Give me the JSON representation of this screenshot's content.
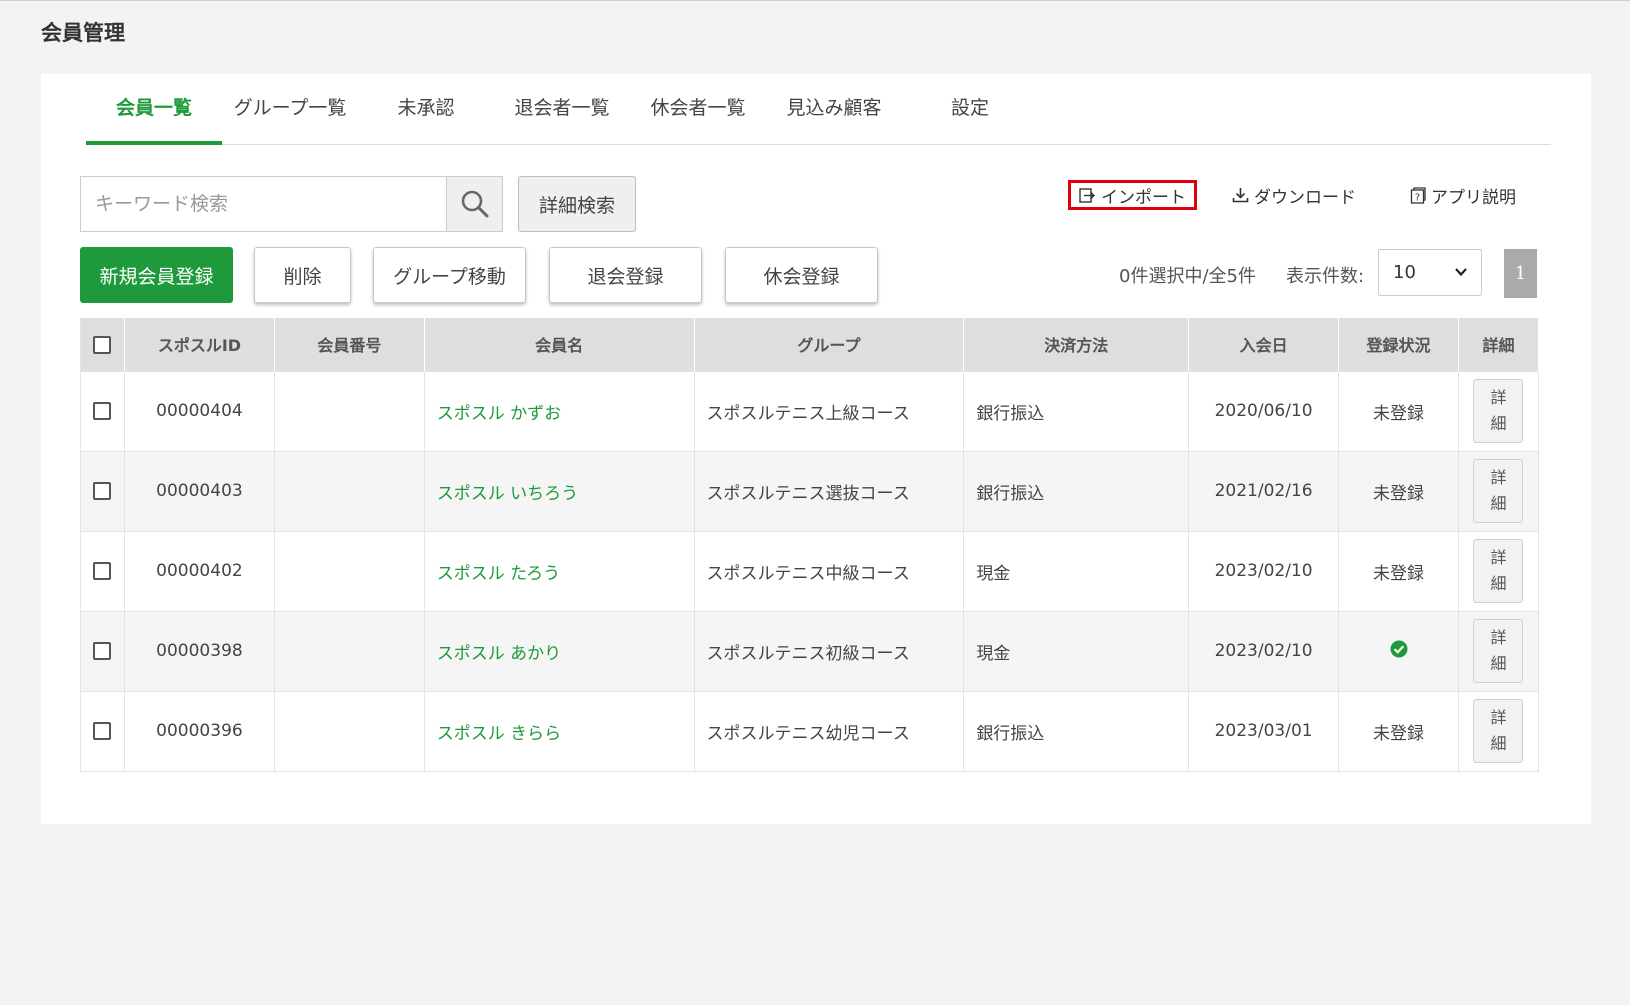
{
  "page": {
    "title": "会員管理"
  },
  "tabs": [
    {
      "label": "会員一覧",
      "active": true
    },
    {
      "label": "グループ一覧",
      "active": false
    },
    {
      "label": "未承認",
      "active": false
    },
    {
      "label": "退会者一覧",
      "active": false
    },
    {
      "label": "休会者一覧",
      "active": false
    },
    {
      "label": "見込み顧客",
      "active": false
    },
    {
      "label": "設定",
      "active": false
    }
  ],
  "search": {
    "placeholder": "キーワード検索",
    "value": "",
    "icon": "search-icon",
    "detail_label": "詳細検索"
  },
  "top_links": {
    "import": {
      "label": "インポート",
      "icon": "import-icon",
      "highlight_color": "#e0000b"
    },
    "download": {
      "label": "ダウンロード",
      "icon": "download-icon"
    },
    "help": {
      "label": "アプリ説明",
      "icon": "help-icon"
    }
  },
  "actions": {
    "new_member": "新規会員登録",
    "delete": "削除",
    "move_group": "グループ移動",
    "withdraw": "退会登録",
    "suspend": "休会登録"
  },
  "selection": {
    "count_text": "0件選択中/全5件",
    "per_page_label": "表示件数:",
    "per_page_value": "10",
    "page": "1"
  },
  "colors": {
    "accent": "#1e9a3c",
    "header_bg": "#dedede"
  },
  "table": {
    "headers": [
      "スポスルID",
      "会員番号",
      "会員名",
      "グループ",
      "決済方法",
      "入会日",
      "登録状況",
      "詳細"
    ],
    "rows": [
      {
        "id": "00000404",
        "number": "",
        "name": "スポスル かずお",
        "group": "スポスルテニス上級コース",
        "payment": "銀行振込",
        "joined": "2020/06/10",
        "status": "未登録",
        "registered": false,
        "detail": [
          "詳",
          "細"
        ]
      },
      {
        "id": "00000403",
        "number": "",
        "name": "スポスル いちろう",
        "group": "スポスルテニス選抜コース",
        "payment": "銀行振込",
        "joined": "2021/02/16",
        "status": "未登録",
        "registered": false,
        "detail": [
          "詳",
          "細"
        ]
      },
      {
        "id": "00000402",
        "number": "",
        "name": "スポスル たろう",
        "group": "スポスルテニス中級コース",
        "payment": "現金",
        "joined": "2023/02/10",
        "status": "未登録",
        "registered": false,
        "detail": [
          "詳",
          "細"
        ]
      },
      {
        "id": "00000398",
        "number": "",
        "name": "スポスル あかり",
        "group": "スポスルテニス初級コース",
        "payment": "現金",
        "joined": "2023/02/10",
        "status": "",
        "registered": true,
        "detail": [
          "詳",
          "細"
        ]
      },
      {
        "id": "00000396",
        "number": "",
        "name": "スポスル きらら",
        "group": "スポスルテニス幼児コース",
        "payment": "銀行振込",
        "joined": "2023/03/01",
        "status": "未登録",
        "registered": false,
        "detail": [
          "詳",
          "細"
        ]
      }
    ]
  }
}
